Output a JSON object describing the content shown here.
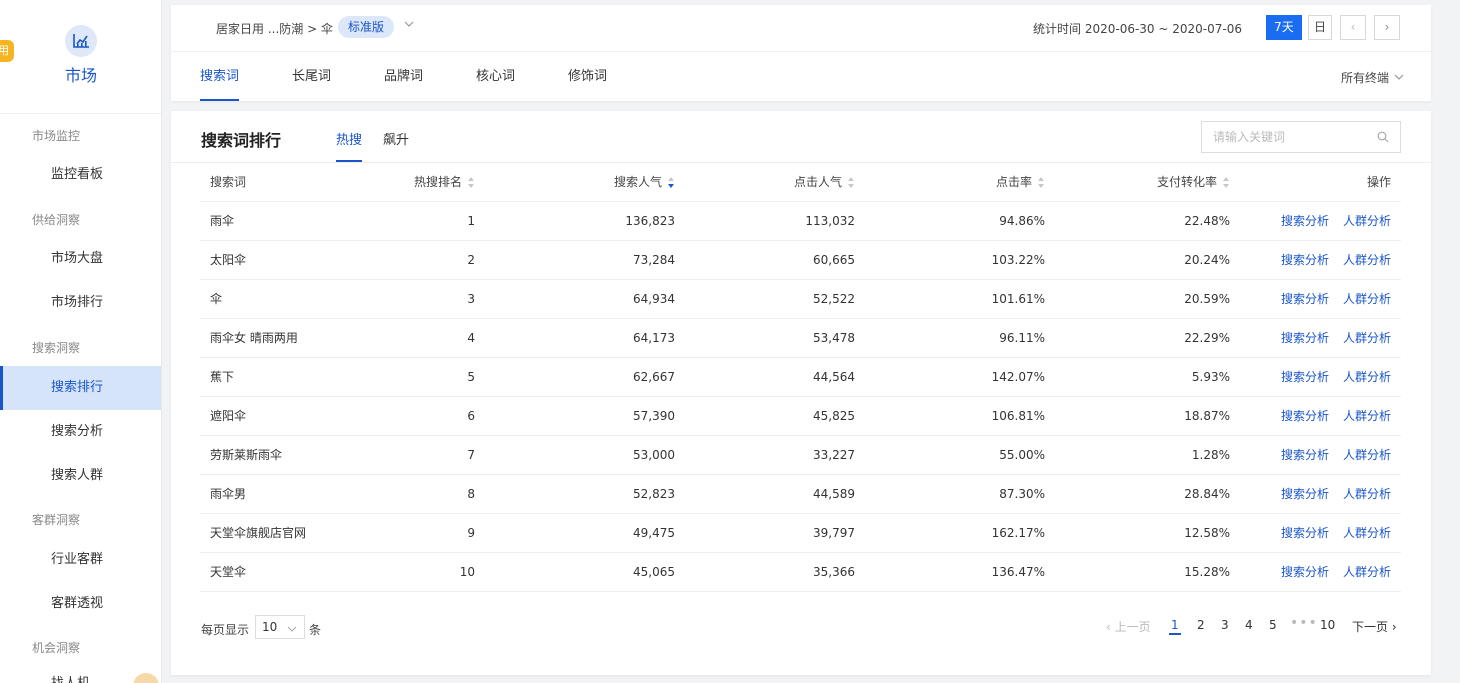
{
  "sidebar": {
    "logo_text": "市场",
    "edge_badge": "用",
    "groups": [
      {
        "label": "市场监控"
      },
      {
        "label": "供给洞察"
      },
      {
        "label": "搜索洞察"
      },
      {
        "label": "客群洞察"
      },
      {
        "label": "机会洞察"
      }
    ],
    "items": [
      {
        "label": "监控看板"
      },
      {
        "label": "市场大盘"
      },
      {
        "label": "市场排行"
      },
      {
        "label": "搜索排行",
        "active": true
      },
      {
        "label": "搜索分析"
      },
      {
        "label": "搜索人群"
      },
      {
        "label": "行业客群"
      },
      {
        "label": "客群透视"
      }
    ],
    "bottom_partial": "找人机"
  },
  "header": {
    "breadcrumb": "居家日用 ...防潮 > 伞",
    "edition": "标准版",
    "stat_time": "统计时间 2020-06-30 ~ 2020-07-06",
    "btn_7day": "7天",
    "btn_day": "日",
    "prev": "‹",
    "next": "›",
    "tabs": [
      {
        "label": "搜索词",
        "active": true
      },
      {
        "label": "长尾词"
      },
      {
        "label": "品牌词"
      },
      {
        "label": "核心词"
      },
      {
        "label": "修饰词"
      }
    ],
    "terminal": "所有终端"
  },
  "main": {
    "title": "搜索词排行",
    "subtabs": [
      {
        "label": "热搜",
        "active": true
      },
      {
        "label": "飙升"
      }
    ],
    "search_placeholder": "请输入关键词",
    "columns": [
      "搜索词",
      "热搜排名",
      "搜索人气",
      "点击人气",
      "点击率",
      "支付转化率",
      "操作"
    ],
    "action_labels": [
      "搜索分析",
      "人群分析"
    ],
    "rows": [
      {
        "term": "雨伞",
        "rank": "1",
        "search_pop": "136,823",
        "click_pop": "113,032",
        "ctr": "94.86%",
        "cvr": "22.48%"
      },
      {
        "term": "太阳伞",
        "rank": "2",
        "search_pop": "73,284",
        "click_pop": "60,665",
        "ctr": "103.22%",
        "cvr": "20.24%"
      },
      {
        "term": "伞",
        "rank": "3",
        "search_pop": "64,934",
        "click_pop": "52,522",
        "ctr": "101.61%",
        "cvr": "20.59%"
      },
      {
        "term": "雨伞女 晴雨两用",
        "rank": "4",
        "search_pop": "64,173",
        "click_pop": "53,478",
        "ctr": "96.11%",
        "cvr": "22.29%"
      },
      {
        "term": "蕉下",
        "rank": "5",
        "search_pop": "62,667",
        "click_pop": "44,564",
        "ctr": "142.07%",
        "cvr": "5.93%"
      },
      {
        "term": "遮阳伞",
        "rank": "6",
        "search_pop": "57,390",
        "click_pop": "45,825",
        "ctr": "106.81%",
        "cvr": "18.87%"
      },
      {
        "term": "劳斯莱斯雨伞",
        "rank": "7",
        "search_pop": "53,000",
        "click_pop": "33,227",
        "ctr": "55.00%",
        "cvr": "1.28%"
      },
      {
        "term": "雨伞男",
        "rank": "8",
        "search_pop": "52,823",
        "click_pop": "44,589",
        "ctr": "87.30%",
        "cvr": "28.84%"
      },
      {
        "term": "天堂伞旗舰店官网",
        "rank": "9",
        "search_pop": "49,475",
        "click_pop": "39,797",
        "ctr": "162.17%",
        "cvr": "12.58%"
      },
      {
        "term": "天堂伞",
        "rank": "10",
        "search_pop": "45,065",
        "click_pop": "35,366",
        "ctr": "136.47%",
        "cvr": "15.28%"
      }
    ]
  },
  "pagination": {
    "per_page_label": "每页显示",
    "per_page_value": "10",
    "per_page_unit": "条",
    "prev_label": "‹ 上一页",
    "pages": [
      "1",
      "2",
      "3",
      "4",
      "5"
    ],
    "current_page": "1",
    "ellipsis": "•••",
    "last_page": "10",
    "next_label": "下一页 ›"
  },
  "colors": {
    "accent": "#1a56c9",
    "primary_button": "#1a6cf0",
    "badge_bg": "#dce7f9",
    "active_side_bg": "#d6e4f9"
  }
}
